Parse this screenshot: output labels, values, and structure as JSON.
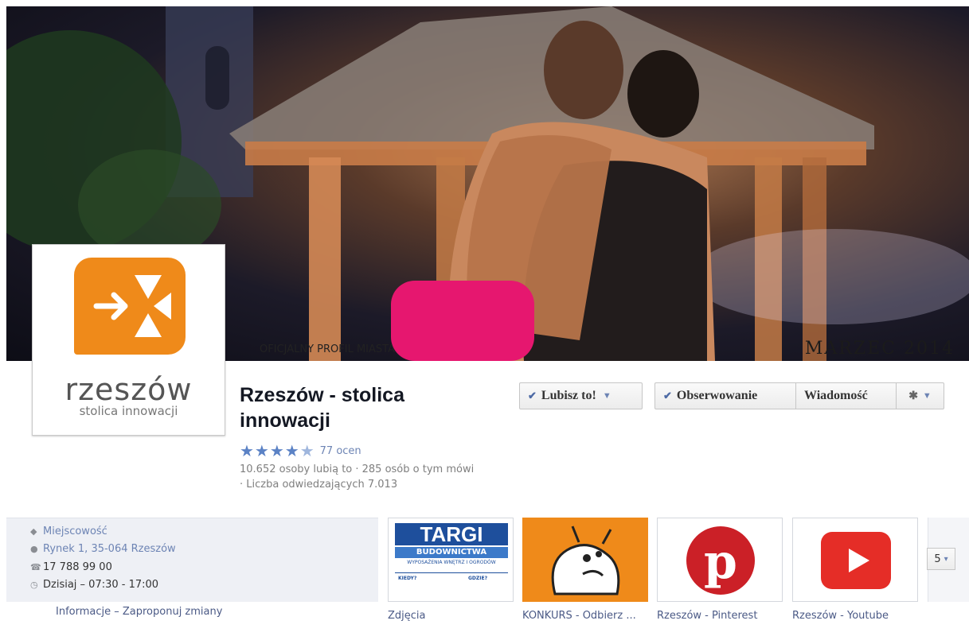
{
  "cover": {
    "caption": "OFICJALNY PROFIL MIASTA",
    "date_text": "MARZEC 2014"
  },
  "profile": {
    "logo_word": "rzeszów",
    "logo_tagline": "stolica innowacji",
    "logo_color": "#ef8a1a"
  },
  "page": {
    "name": "Rzeszów - stolica innowacji",
    "rating_stars": "★★★★",
    "rating_half": "★",
    "rating_value": 4.5,
    "rating_count": "77 ocen",
    "stats_line": "10.652 osoby lubią to · 285 osób o tym mówi · Liczba odwiedzających 7.013"
  },
  "actions": {
    "like_label": "Lubisz to!",
    "follow_label": "Obserwowanie",
    "message_label": "Wiadomość",
    "check_glyph": "✔",
    "caret_glyph": "▼",
    "gear_glyph": "✱"
  },
  "info": {
    "category": "Miejscowość",
    "address": "Rynek 1, 35-064 Rzeszów",
    "phone": "17 788 99 00",
    "hours": "Dzisiaj – 07:30 - 17:00",
    "links": "Informacje – Zaproponuj zmiany",
    "icons": {
      "category": "tag-icon",
      "address": "map-pin-icon",
      "phone": "phone-icon",
      "hours": "clock-icon"
    }
  },
  "apps": [
    {
      "label": "Zdjęcia",
      "thumb_title": "TARGI",
      "thumb_subtitle": "BUDOWNICTWA",
      "thumb_line": "WYPOSAŻENIA WNĘTRZ I OGRODÓW",
      "thumb_col1": "KIEDY?",
      "thumb_col2": "GDZIE?"
    },
    {
      "label": "KONKURS - Odbierz ...",
      "bg": "#ef8a1a"
    },
    {
      "label": "Rzeszów - Pinterest",
      "icon": "pinterest-icon",
      "color": "#cb2027"
    },
    {
      "label": "Rzeszów - Youtube",
      "icon": "youtube-icon",
      "color": "#e52d27"
    }
  ],
  "more_apps": {
    "count": "5",
    "caret": "▾"
  }
}
